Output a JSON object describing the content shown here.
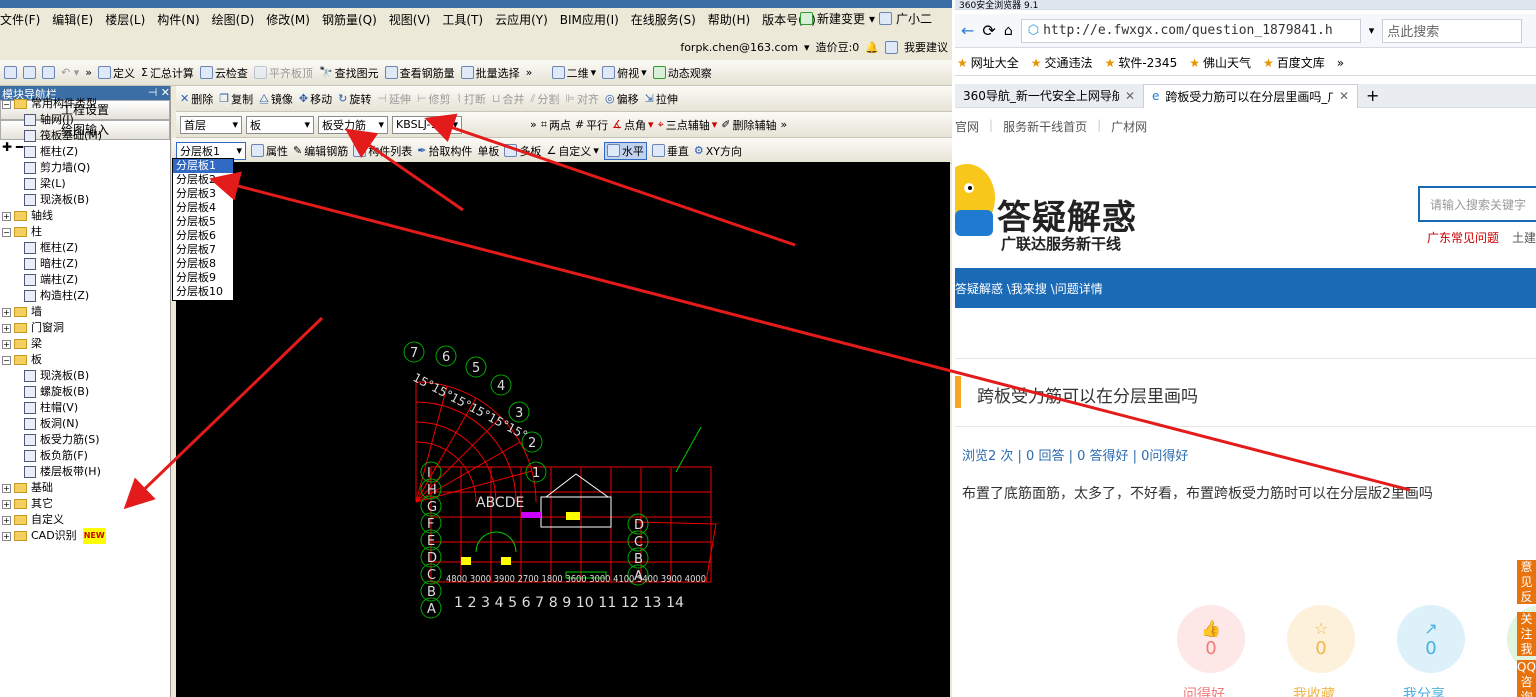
{
  "app": {
    "menu": [
      "文件(F)",
      "编辑(E)",
      "楼层(L)",
      "构件(N)",
      "绘图(D)",
      "修改(M)",
      "钢筋量(Q)",
      "视图(V)",
      "工具(T)",
      "云应用(Y)",
      "BIM应用(I)",
      "在线服务(S)",
      "帮助(H)",
      "版本号(B)"
    ],
    "menu_right": {
      "new_change": "新建变更",
      "user_short": "广小二"
    },
    "account": {
      "email": "forpk.chen@163.com",
      "beans": "造价豆:0",
      "suggest": "我要建议"
    },
    "toolbar1": {
      "define": "定义",
      "calc": "汇总计算",
      "cloud_check": "云检查",
      "level_top": "平齐板顶",
      "find": "查找图元",
      "view_rebar": "查看钢筋量",
      "batch_select": "批量选择",
      "view2d": "二维",
      "top_view": "俯视",
      "dynamic": "动态观察"
    },
    "toolbar2": {
      "delete": "删除",
      "copy": "复制",
      "mirror": "镜像",
      "move": "移动",
      "rotate": "旋转",
      "extend": "延伸",
      "trim": "修剪",
      "break": "打断",
      "merge": "合并",
      "split": "分割",
      "align": "对齐",
      "offset": "偏移",
      "stretch": "拉伸"
    },
    "selectors": {
      "floor": "首层",
      "type": "板",
      "component": "板受力筋",
      "name": "KBSLJ-1",
      "layer": "分层板1"
    },
    "toolbar3": {
      "two_point": "两点",
      "parallel": "平行",
      "point_angle": "点角",
      "three_point_axis": "三点辅轴",
      "delete_axis": "删除辅轴"
    },
    "toolbar4": {
      "props": "属性",
      "edit_rebar": "编辑钢筋",
      "comp_list": "构件列表",
      "pick": "拾取构件",
      "single": "单板",
      "multi": "多板",
      "custom": "自定义",
      "horizontal": "水平",
      "vertical": "垂直",
      "xy": "XY方向"
    },
    "layer_options": [
      "分层板1",
      "分层板2",
      "分层板3",
      "分层板4",
      "分层板5",
      "分层板6",
      "分层板7",
      "分层板8",
      "分层板9",
      "分层板10"
    ],
    "nav": {
      "title": "模块导航栏",
      "btn_settings": "工程设置",
      "btn_draw": "绘图输入",
      "tree": [
        {
          "label": "常用构件类型",
          "level": 0,
          "type": "folder",
          "exp": "−"
        },
        {
          "label": "轴网(J)",
          "level": 1
        },
        {
          "label": "筏板基础(M)",
          "level": 1
        },
        {
          "label": "框柱(Z)",
          "level": 1
        },
        {
          "label": "剪力墙(Q)",
          "level": 1
        },
        {
          "label": "梁(L)",
          "level": 1
        },
        {
          "label": "现浇板(B)",
          "level": 1
        },
        {
          "label": "轴线",
          "level": 0,
          "type": "folder",
          "exp": "+"
        },
        {
          "label": "柱",
          "level": 0,
          "type": "folder",
          "exp": "−"
        },
        {
          "label": "框柱(Z)",
          "level": 1
        },
        {
          "label": "暗柱(Z)",
          "level": 1
        },
        {
          "label": "端柱(Z)",
          "level": 1
        },
        {
          "label": "构造柱(Z)",
          "level": 1
        },
        {
          "label": "墙",
          "level": 0,
          "type": "folder",
          "exp": "+"
        },
        {
          "label": "门窗洞",
          "level": 0,
          "type": "folder",
          "exp": "+"
        },
        {
          "label": "梁",
          "level": 0,
          "type": "folder",
          "exp": "+"
        },
        {
          "label": "板",
          "level": 0,
          "type": "folder",
          "exp": "−"
        },
        {
          "label": "现浇板(B)",
          "level": 1
        },
        {
          "label": "螺旋板(B)",
          "level": 1
        },
        {
          "label": "柱帽(V)",
          "level": 1
        },
        {
          "label": "板洞(N)",
          "level": 1
        },
        {
          "label": "板受力筋(S)",
          "level": 1
        },
        {
          "label": "板负筋(F)",
          "level": 1
        },
        {
          "label": "楼层板带(H)",
          "level": 1
        },
        {
          "label": "基础",
          "level": 0,
          "type": "folder",
          "exp": "+"
        },
        {
          "label": "其它",
          "level": 0,
          "type": "folder",
          "exp": "+"
        },
        {
          "label": "自定义",
          "level": 0,
          "type": "folder",
          "exp": "+"
        },
        {
          "label": "CAD识别",
          "level": 0,
          "type": "folder",
          "exp": "+"
        }
      ],
      "new_badge": "NEW"
    },
    "canvas_labels": {
      "arc_angles": "15°15°15°15°15°15°",
      "top_nums": [
        "7",
        "6",
        "5",
        "4",
        "3",
        "2",
        "1"
      ],
      "bottom_nums": "1 2 3 4 5 6 7 8 9 10 11 12 13 14",
      "left_letters": [
        "I",
        "H",
        "G",
        "F",
        "E",
        "D",
        "C",
        "B",
        "A"
      ],
      "inner_letters": "ABCDE",
      "right_letters": [
        "D",
        "C",
        "B",
        "A"
      ],
      "dims_row": "4800 3000 3900 2700 1800 3600 3000 4100 3400 3900 4000"
    }
  },
  "browser": {
    "title": "360安全浏览器 9.1",
    "url": "http://e.fwxgx.com/question_1879841.h",
    "search_placeholder": "点此搜索",
    "favorites": [
      "网址大全",
      "交通违法",
      "软件-2345",
      "佛山天气",
      "百度文库"
    ],
    "tabs": [
      "360导航_新一代安全上网导航",
      "跨板受力筋可以在分层里画吗_广"
    ],
    "subnav": [
      "官网",
      "服务新干线首页",
      "广材网"
    ],
    "logo_main": "答疑解惑",
    "logo_sub": "广联达服务新干线",
    "site_search_placeholder": "请输入搜索关键字",
    "hot_links": [
      "广东常见问题",
      "土建"
    ],
    "breadcrumb": "答疑解惑 \\我来搜 \\问题详情",
    "question_title": "跨板受力筋可以在分层里画吗",
    "stats": "浏览2 次 | 0 回答 | 0 答得好 | 0问得好",
    "question_body": "布置了底筋面筋，太多了，不好看，布置跨板受力筋时可以在分层版2里画吗",
    "actions": [
      {
        "count": "0",
        "label": "问得好",
        "color": "#f07b7b",
        "bg": "#fde7e7"
      },
      {
        "count": "0",
        "label": "我收藏",
        "color": "#f0b64a",
        "bg": "#fdf1dc"
      },
      {
        "count": "0",
        "label": "我分享",
        "color": "#4ab0e0",
        "bg": "#ddf1fb"
      }
    ],
    "side_tabs": [
      "意见反馈",
      "关注我们",
      "QQ咨询"
    ]
  },
  "colors": {
    "annotation": "#e31b1b",
    "blue_band": "#1b6ab5",
    "accent": "#f5a623"
  }
}
